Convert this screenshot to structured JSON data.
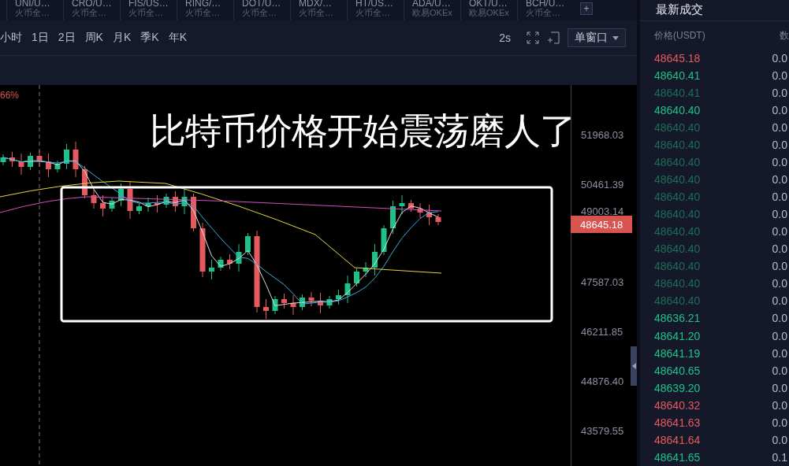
{
  "tabs": [
    {
      "pair": "UNI/U…",
      "exchange": "火币全…"
    },
    {
      "pair": "CRO/U…",
      "exchange": "火币全…"
    },
    {
      "pair": "FIS/US…",
      "exchange": "火币全…"
    },
    {
      "pair": "RING/…",
      "exchange": "火币全…"
    },
    {
      "pair": "DOT/U…",
      "exchange": "火币全…"
    },
    {
      "pair": "MDX/…",
      "exchange": "火币全…"
    },
    {
      "pair": "HT/US…",
      "exchange": "火币全…"
    },
    {
      "pair": "ADA/U…",
      "exchange": "欧易OKEx"
    },
    {
      "pair": "OKT/U…",
      "exchange": "欧易OKEx"
    },
    {
      "pair": "BCH/U…",
      "exchange": "火币全…"
    }
  ],
  "add_tab": "+",
  "toolbar": {
    "intervals": [
      "小时",
      "1日",
      "2日",
      "周K",
      "月K",
      "季K",
      "年K"
    ],
    "refresh": "2s",
    "window_mode": "单窗口"
  },
  "chart": {
    "change": "66%",
    "overlay_text": "比特币价格开始震荡磨人了",
    "price_labels": [
      "51968.03",
      "50461.39",
      "49003.14",
      "47587.03",
      "46211.85",
      "44876.40",
      "43579.55"
    ],
    "last_price": "48645.18"
  },
  "trades": {
    "title": "最新成交",
    "columns": [
      "价格(USDT)",
      "数"
    ],
    "rows": [
      {
        "price": "48645.18",
        "qty": "0.0",
        "color": "#e55a5e"
      },
      {
        "price": "48640.41",
        "qty": "0.0",
        "color": "#1fc08a"
      },
      {
        "price": "48640.41",
        "qty": "0.0",
        "color": "#1b6e58"
      },
      {
        "price": "48640.40",
        "qty": "0.0",
        "color": "#1fc08a"
      },
      {
        "price": "48640.40",
        "qty": "0.0",
        "color": "#1b6e58"
      },
      {
        "price": "48640.40",
        "qty": "0.0",
        "color": "#1b6e58"
      },
      {
        "price": "48640.40",
        "qty": "0.0",
        "color": "#1b6e58"
      },
      {
        "price": "48640.40",
        "qty": "0.0",
        "color": "#1b6e58"
      },
      {
        "price": "48640.40",
        "qty": "0.0",
        "color": "#1b6e58"
      },
      {
        "price": "48640.40",
        "qty": "0.0",
        "color": "#1b6e58"
      },
      {
        "price": "48640.40",
        "qty": "0.0",
        "color": "#1b6e58"
      },
      {
        "price": "48640.40",
        "qty": "0.0",
        "color": "#1b6e58"
      },
      {
        "price": "48640.40",
        "qty": "0.0",
        "color": "#1b6e58"
      },
      {
        "price": "48640.40",
        "qty": "0.0",
        "color": "#1b6e58"
      },
      {
        "price": "48640.40",
        "qty": "0.0",
        "color": "#1b6e58"
      },
      {
        "price": "48636.21",
        "qty": "0.0",
        "color": "#1fc08a"
      },
      {
        "price": "48641.20",
        "qty": "0.0",
        "color": "#1fc08a"
      },
      {
        "price": "48641.19",
        "qty": "0.0",
        "color": "#1fc08a"
      },
      {
        "price": "48640.65",
        "qty": "0.0",
        "color": "#1fc08a"
      },
      {
        "price": "48639.20",
        "qty": "0.0",
        "color": "#1fc08a"
      },
      {
        "price": "48640.32",
        "qty": "0.0",
        "color": "#e55a5e"
      },
      {
        "price": "48641.63",
        "qty": "0.0",
        "color": "#e55a5e"
      },
      {
        "price": "48641.64",
        "qty": "0.0",
        "color": "#e55a5e"
      },
      {
        "price": "48641.65",
        "qty": "0.1",
        "color": "#1fc08a"
      }
    ]
  }
}
